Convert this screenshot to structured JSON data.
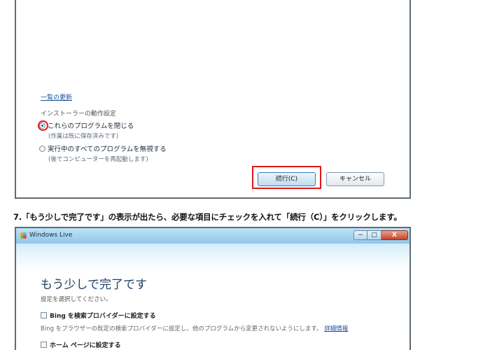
{
  "installer": {
    "update_link": "一覧の更新",
    "section_label": "インストーラーの動作設定",
    "options": [
      {
        "label": "これらのプログラムを閉じる",
        "note": "(作業は既に保存済みです)",
        "checked": true
      },
      {
        "label": "実行中のすべてのプログラムを無視する",
        "note": "(後でコンピューターを再起動します)",
        "checked": false
      }
    ],
    "continue_label": "続行(C)",
    "cancel_label": "キャンセル"
  },
  "step_text": "7.「もう少しで完了です」の表示が出たら、必要な項目にチェックを入れて「続行（C）」をクリックします。",
  "live_window": {
    "title": "Windows Live",
    "close_glyph": "X",
    "heading": "もう少しで完了です",
    "subtitle": "設定を選択してください。",
    "options": [
      {
        "label": "Bing を検索プロバイダーに設定する",
        "checked": false
      },
      {
        "label": "ホーム ページに設定する",
        "checked": false
      }
    ],
    "bing_desc": "Bing をブラウザーの既定の検索プロバイダーに設定し、他のプログラムから変更されないようにします。",
    "details_link": "詳細情報"
  },
  "colors": {
    "highlight": "#e01818",
    "link": "#1a4f9c",
    "heading": "#1f3e63"
  }
}
